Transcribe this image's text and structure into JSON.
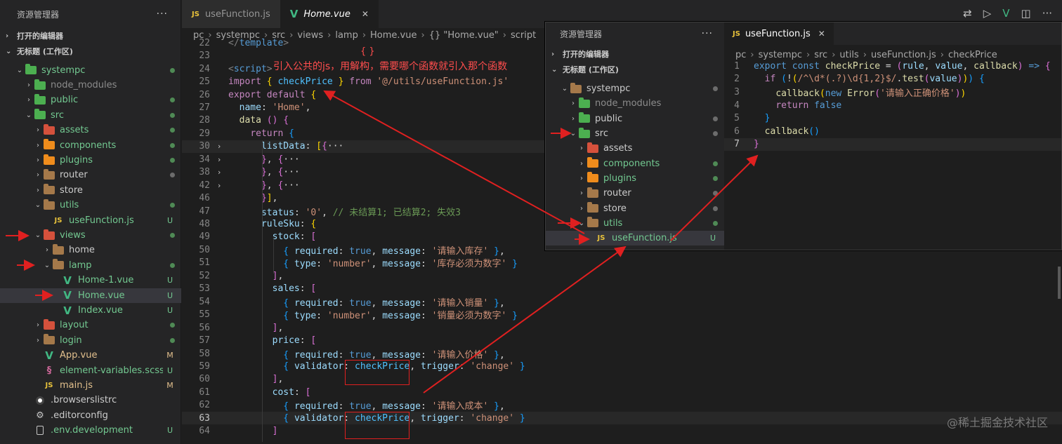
{
  "left_sidebar": {
    "title": "资源管理器",
    "more": "···",
    "open_editors": "打开的编辑器",
    "workspace": "无标题 (工作区)",
    "tree": [
      {
        "label": "systempc",
        "icon": "folder-green",
        "color": "green",
        "status": "dot",
        "depth": 1,
        "tw": "⌄"
      },
      {
        "label": "node_modules",
        "icon": "folder-green",
        "color": "dim",
        "status": "",
        "depth": 2,
        "tw": "›"
      },
      {
        "label": "public",
        "icon": "folder-green",
        "color": "green",
        "status": "dot",
        "depth": 2,
        "tw": "›"
      },
      {
        "label": "src",
        "icon": "folder-green",
        "color": "green",
        "status": "dot",
        "depth": 2,
        "tw": "⌄"
      },
      {
        "label": "assets",
        "icon": "folder-red",
        "color": "green",
        "status": "dot",
        "depth": 3,
        "tw": "›"
      },
      {
        "label": "components",
        "icon": "folder-orange",
        "color": "green",
        "status": "dot",
        "depth": 3,
        "tw": "›"
      },
      {
        "label": "plugins",
        "icon": "folder-orange",
        "color": "green",
        "status": "dot",
        "depth": 3,
        "tw": "›"
      },
      {
        "label": "router",
        "icon": "folder-brown",
        "color": "light",
        "status": "dot-gray",
        "depth": 3,
        "tw": "›"
      },
      {
        "label": "store",
        "icon": "folder-brown",
        "color": "light",
        "status": "",
        "depth": 3,
        "tw": "›"
      },
      {
        "label": "utils",
        "icon": "folder-brown",
        "color": "green",
        "status": "dot",
        "depth": 3,
        "tw": "⌄"
      },
      {
        "label": "useFunction.js",
        "icon": "js",
        "color": "green",
        "status": "U",
        "depth": 4,
        "tw": ""
      },
      {
        "label": "views",
        "icon": "folder-red",
        "color": "green",
        "status": "dot",
        "depth": 3,
        "tw": "⌄"
      },
      {
        "label": "home",
        "icon": "folder-brown",
        "color": "light",
        "status": "",
        "depth": 4,
        "tw": "›"
      },
      {
        "label": "lamp",
        "icon": "folder-brown",
        "color": "green",
        "status": "dot",
        "depth": 4,
        "tw": "⌄"
      },
      {
        "label": "Home-1.vue",
        "icon": "vue",
        "color": "green",
        "status": "U",
        "depth": 5,
        "tw": ""
      },
      {
        "label": "Home.vue",
        "icon": "vue",
        "color": "green",
        "status": "U",
        "depth": 5,
        "tw": "",
        "selected": true
      },
      {
        "label": "Index.vue",
        "icon": "vue",
        "color": "green",
        "status": "U",
        "depth": 5,
        "tw": ""
      },
      {
        "label": "layout",
        "icon": "folder-red",
        "color": "green",
        "status": "dot",
        "depth": 3,
        "tw": "›"
      },
      {
        "label": "login",
        "icon": "folder-brown",
        "color": "green",
        "status": "dot",
        "depth": 3,
        "tw": "›"
      },
      {
        "label": "App.vue",
        "icon": "vue",
        "color": "yellow",
        "status": "M",
        "depth": 3,
        "tw": ""
      },
      {
        "label": "element-variables.scss",
        "icon": "scss",
        "color": "green",
        "status": "U",
        "depth": 3,
        "tw": ""
      },
      {
        "label": "main.js",
        "icon": "js",
        "color": "yellow",
        "status": "M",
        "depth": 3,
        "tw": ""
      },
      {
        "label": ".browserslistrc",
        "icon": "circle",
        "color": "light",
        "status": "",
        "depth": 2,
        "tw": ""
      },
      {
        "label": ".editorconfig",
        "icon": "gear",
        "color": "light",
        "status": "",
        "depth": 2,
        "tw": ""
      },
      {
        "label": ".env.development",
        "icon": "file",
        "color": "green",
        "status": "U",
        "depth": 2,
        "tw": ""
      }
    ]
  },
  "editor": {
    "tabs": [
      {
        "label": "useFunction.js",
        "icon": "JS",
        "active": false
      },
      {
        "label": "Home.vue",
        "icon": "V",
        "active": true
      }
    ],
    "breadcrumb": [
      "pc",
      "systempc",
      "src",
      "views",
      "lamp",
      "Home.vue",
      "{} \"Home.vue\"",
      "script"
    ],
    "lines": [
      {
        "n": "22",
        "fold": "",
        "html": "<span class='t'>&lt;/</span><span class='k'>template</span><span class='t'>&gt;</span>"
      },
      {
        "n": "23",
        "fold": "",
        "html": ""
      },
      {
        "n": "24",
        "fold": "",
        "html": "<span class='t'>&lt;</span><span class='k'>script</span><span class='t'>&gt;</span>"
      },
      {
        "n": "25",
        "fold": "",
        "html": "<span class='kp'>import</span> <span class='b1'>{</span> <span class='v'>checkPrice</span> <span class='b1'>}</span> <span class='kp'>from</span> <span class='s'>'@/utils/useFunction.js'</span>"
      },
      {
        "n": "26",
        "fold": "",
        "html": "<span class='kp'>export</span> <span class='kp'>default</span> <span class='b1'>{</span>"
      },
      {
        "n": "27",
        "fold": "",
        "html": "  <span class='p'>name</span><span class='w'>: </span><span class='s'>'Home'</span><span class='w'>,</span>"
      },
      {
        "n": "28",
        "fold": "",
        "html": "  <span class='f'>data</span> <span class='b2'>()</span> <span class='b2'>{</span>"
      },
      {
        "n": "29",
        "fold": "",
        "html": "    <span class='kp'>return</span> <span class='b3'>{</span>"
      },
      {
        "n": "30",
        "fold": "›",
        "html": "      <span class='p'>listData</span><span class='w'>: </span><span class='b1'>[</span><span class='b2'>{</span><span class='w'>···</span>",
        "hl": true
      },
      {
        "n": "34",
        "fold": "›",
        "html": "      <span class='b2'>}</span><span class='w'>, </span><span class='b2'>{</span><span class='w'>···</span>"
      },
      {
        "n": "38",
        "fold": "›",
        "html": "      <span class='b2'>}</span><span class='w'>, </span><span class='b2'>{</span><span class='w'>···</span>"
      },
      {
        "n": "42",
        "fold": "›",
        "html": "      <span class='b2'>}</span><span class='w'>, </span><span class='b2'>{</span><span class='w'>···</span>"
      },
      {
        "n": "46",
        "fold": "",
        "html": "      <span class='b2'>}</span><span class='b1'>]</span><span class='w'>,</span>"
      },
      {
        "n": "47",
        "fold": "",
        "html": "      <span class='p'>status</span><span class='w'>: </span><span class='s'>'0'</span><span class='w'>, </span><span class='cm'>// 未结算1; 已结算2; 失效3</span>"
      },
      {
        "n": "48",
        "fold": "",
        "html": "      <span class='p'>ruleSku</span><span class='w'>: </span><span class='b1'>{</span>"
      },
      {
        "n": "49",
        "fold": "",
        "html": "        <span class='p'>stock</span><span class='w'>: </span><span class='b2'>[</span>"
      },
      {
        "n": "50",
        "fold": "",
        "html": "          <span class='b3'>{</span> <span class='p'>required</span><span class='w'>: </span><span class='k'>true</span><span class='w'>, </span><span class='p'>message</span><span class='w'>: </span><span class='s'>'请输入库存'</span> <span class='b3'>}</span><span class='w'>,</span>"
      },
      {
        "n": "51",
        "fold": "",
        "html": "          <span class='b3'>{</span> <span class='p'>type</span><span class='w'>: </span><span class='s'>'number'</span><span class='w'>, </span><span class='p'>message</span><span class='w'>: </span><span class='s'>'库存必须为数字'</span> <span class='b3'>}</span>"
      },
      {
        "n": "52",
        "fold": "",
        "html": "        <span class='b2'>]</span><span class='w'>,</span>"
      },
      {
        "n": "53",
        "fold": "",
        "html": "        <span class='p'>sales</span><span class='w'>: </span><span class='b2'>[</span>"
      },
      {
        "n": "54",
        "fold": "",
        "html": "          <span class='b3'>{</span> <span class='p'>required</span><span class='w'>: </span><span class='k'>true</span><span class='w'>, </span><span class='p'>message</span><span class='w'>: </span><span class='s'>'请输入销量'</span> <span class='b3'>}</span><span class='w'>,</span>"
      },
      {
        "n": "55",
        "fold": "",
        "html": "          <span class='b3'>{</span> <span class='p'>type</span><span class='w'>: </span><span class='s'>'number'</span><span class='w'>, </span><span class='p'>message</span><span class='w'>: </span><span class='s'>'销量必须为数字'</span> <span class='b3'>}</span>"
      },
      {
        "n": "56",
        "fold": "",
        "html": "        <span class='b2'>]</span><span class='w'>,</span>"
      },
      {
        "n": "57",
        "fold": "",
        "html": "        <span class='p'>price</span><span class='w'>: </span><span class='b2'>[</span>"
      },
      {
        "n": "58",
        "fold": "",
        "html": "          <span class='b3'>{</span> <span class='p'>required</span><span class='w'>: </span><span class='k'>true</span><span class='w'>, </span><span class='p'>message</span><span class='w'>: </span><span class='s'>'请输入价格'</span> <span class='b3'>}</span><span class='w'>,</span>"
      },
      {
        "n": "59",
        "fold": "",
        "html": "          <span class='b3'>{</span> <span class='p'>validator</span><span class='w'>: </span><span class='v'>checkPrice</span><span class='w'>, </span><span class='p'>trigger</span><span class='w'>: </span><span class='s'>'change'</span> <span class='b3'>}</span>"
      },
      {
        "n": "60",
        "fold": "",
        "html": "        <span class='b2'>]</span><span class='w'>,</span>"
      },
      {
        "n": "61",
        "fold": "",
        "html": "        <span class='p'>cost</span><span class='w'>: </span><span class='b2'>[</span>"
      },
      {
        "n": "62",
        "fold": "",
        "html": "          <span class='b3'>{</span> <span class='p'>required</span><span class='w'>: </span><span class='k'>true</span><span class='w'>, </span><span class='p'>message</span><span class='w'>: </span><span class='s'>'请输入成本'</span> <span class='b3'>}</span><span class='w'>,</span>"
      },
      {
        "n": "63",
        "fold": "",
        "html": "          <span class='b3'>{</span> <span class='p'>validator</span><span class='w'>: </span><span class='v'>checkPrice</span><span class='w'>, </span><span class='p'>trigger</span><span class='w'>: </span><span class='s'>'change'</span> <span class='b3'>}</span>",
        "cur": true
      },
      {
        "n": "64",
        "fold": "",
        "html": "        <span class='b2'>]</span>"
      }
    ]
  },
  "overlay": {
    "sidebar_title": "资源管理器",
    "more": "···",
    "open_editors": "打开的编辑器",
    "workspace": "无标题 (工作区)",
    "tree": [
      {
        "label": "systempc",
        "icon": "folder-brown",
        "color": "light",
        "status": "dot-gray",
        "depth": 1,
        "tw": "⌄"
      },
      {
        "label": "node_modules",
        "icon": "folder-green",
        "color": "dim",
        "status": "",
        "depth": 2,
        "tw": "›"
      },
      {
        "label": "public",
        "icon": "folder-green",
        "color": "light",
        "status": "dot-gray",
        "depth": 2,
        "tw": "›"
      },
      {
        "label": "src",
        "icon": "folder-green",
        "color": "light",
        "status": "dot-gray",
        "depth": 2,
        "tw": "⌄"
      },
      {
        "label": "assets",
        "icon": "folder-red",
        "color": "light",
        "status": "",
        "depth": 3,
        "tw": "›"
      },
      {
        "label": "components",
        "icon": "folder-orange",
        "color": "green",
        "status": "dot",
        "depth": 3,
        "tw": "›"
      },
      {
        "label": "plugins",
        "icon": "folder-orange",
        "color": "green",
        "status": "dot",
        "depth": 3,
        "tw": "›"
      },
      {
        "label": "router",
        "icon": "folder-brown",
        "color": "light",
        "status": "dot-gray",
        "depth": 3,
        "tw": "›"
      },
      {
        "label": "store",
        "icon": "folder-brown",
        "color": "light",
        "status": "dot-gray",
        "depth": 3,
        "tw": "›"
      },
      {
        "label": "utils",
        "icon": "folder-brown",
        "color": "green",
        "status": "dot",
        "depth": 3,
        "tw": "⌄"
      },
      {
        "label": "useFunction.js",
        "icon": "js",
        "color": "green",
        "status": "U",
        "depth": 4,
        "tw": "",
        "selected": true
      }
    ],
    "tab": "useFunction.js",
    "breadcrumb": [
      "pc",
      "systempc",
      "src",
      "utils",
      "useFunction.js",
      "checkPrice"
    ],
    "lines": [
      {
        "n": "1",
        "html": "<span class='k'>export</span> <span class='k'>const</span> <span class='f'>checkPrice</span> <span class='w'>=</span> <span class='b2'>(</span><span class='p'>rule</span><span class='w'>, </span><span class='p'>value</span><span class='w'>, </span><span class='f'>callback</span><span class='b2'>)</span> <span class='k'>=&gt;</span> <span class='b2'>{</span>"
      },
      {
        "n": "2",
        "html": "  <span class='kp'>if</span> <span class='b3'>(</span><span class='w'>!</span><span class='b1'>(</span><span class='s'>/^\\d*(.?)\\d{1,2}$/</span><span class='w'>.</span><span class='f'>test</span><span class='b2'>(</span><span class='p'>value</span><span class='b2'>)</span><span class='b1'>)</span><span class='b3'>)</span> <span class='b3'>{</span>"
      },
      {
        "n": "3",
        "html": "    <span class='f'>callback</span><span class='b1'>(</span><span class='k'>new</span> <span class='f'>Error</span><span class='b2'>(</span><span class='s'>'请输入正确价格'</span><span class='b2'>)</span><span class='b1'>)</span>"
      },
      {
        "n": "4",
        "html": "    <span class='kp'>return</span> <span class='k'>false</span>"
      },
      {
        "n": "5",
        "html": "  <span class='b3'>}</span>"
      },
      {
        "n": "6",
        "html": "  <span class='f'>callback</span><span class='b3'>()</span>"
      },
      {
        "n": "7",
        "html": "<span class='b2'>}</span>",
        "cur": true
      }
    ]
  },
  "annotations": {
    "note": "引入公共的js，用解构，需要哪个函数就引入那个函数",
    "braces": "{ }",
    "watermark": "@稀土掘金技术社区"
  },
  "colors": {
    "arrow": "#e02020",
    "background": "#1e1e1e",
    "sidebar": "#252526"
  }
}
